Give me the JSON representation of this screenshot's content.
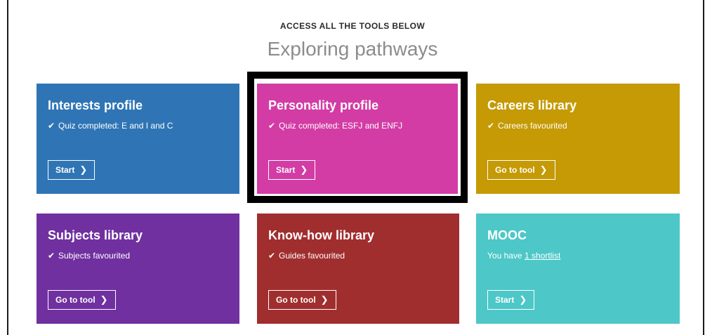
{
  "header": {
    "eyebrow": "ACCESS ALL THE TOOLS BELOW",
    "title": "Exploring pathways"
  },
  "tiles": [
    {
      "name": "interests",
      "title": "Interests profile",
      "status_icon": "check-icon",
      "status": "Quiz completed: E and I and C",
      "button": "Start",
      "color": "#2f75b5"
    },
    {
      "name": "personality",
      "title": "Personality profile",
      "status_icon": "check-icon",
      "status": "Quiz completed: ESFJ and ENFJ",
      "button": "Start",
      "color": "#d33ca5",
      "highlighted": true
    },
    {
      "name": "careers",
      "title": "Careers library",
      "status_icon": "check-icon",
      "status": "Careers favourited",
      "button": "Go to tool",
      "color": "#c59a04"
    },
    {
      "name": "subjects",
      "title": "Subjects library",
      "status_icon": "check-icon",
      "status": "Subjects favourited",
      "button": "Go to tool",
      "color": "#7030a0"
    },
    {
      "name": "knowhow",
      "title": "Know-how library",
      "status_icon": "check-icon",
      "status": "Guides favourited",
      "button": "Go to tool",
      "color": "#a12e2e"
    },
    {
      "name": "mooc",
      "title": "MOOC",
      "status_prefix": "You have ",
      "status_link": "1 shortlist",
      "button": "Start",
      "color": "#4dc7c7"
    }
  ],
  "icons": {
    "check": "✔",
    "chevron": "❯"
  }
}
